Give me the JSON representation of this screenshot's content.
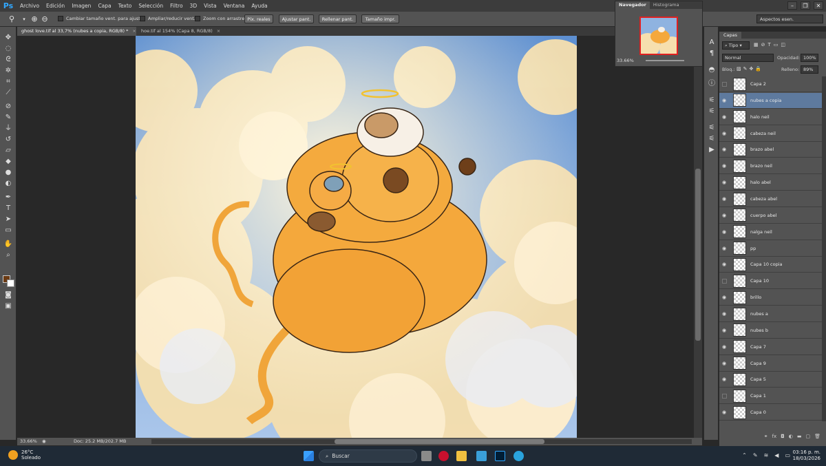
{
  "app": {
    "logo": "Ps"
  },
  "menu": [
    "Archivo",
    "Edición",
    "Imagen",
    "Capa",
    "Texto",
    "Selección",
    "Filtro",
    "3D",
    "Vista",
    "Ventana",
    "Ayuda"
  ],
  "options": {
    "check_resize": "Cambiar tamaño vent. para ajustar",
    "check_zoom_all": "Ampliar/reducir vent.",
    "check_scrubby": "Zoom con arrastre",
    "btn_actual": "Píx. reales",
    "btn_fit": "Ajustar pant.",
    "btn_fill": "Rellenar pant.",
    "btn_print": "Tamaño impr.",
    "workspace": "Aspectos esen."
  },
  "tabs": [
    {
      "label": "ghost love.tif al 33,7% (nubes a copia, RGB/8) *",
      "close": "×"
    },
    {
      "label": "hoe.tif al 154% (Capa 8, RGB/8)",
      "close": "×"
    }
  ],
  "status": {
    "zoom": "33.66%",
    "doc": "Doc: 25.2 MB/202.7 MB"
  },
  "navigator": {
    "tab_nav": "Navegador",
    "tab_hist": "Histograma",
    "zoom": "33.66%"
  },
  "layers_panel": {
    "tab": "Capas",
    "filter": "Tipo",
    "blend": "Normal",
    "opacity_label": "Opacidad:",
    "opacity": "100%",
    "lock_label": "Bloq.:",
    "fill_label": "Relleno:",
    "fill": "89%",
    "items": [
      {
        "name": "Capa 2",
        "visible": false
      },
      {
        "name": "nubes a copia",
        "visible": true,
        "selected": true
      },
      {
        "name": "halo neil",
        "visible": true
      },
      {
        "name": "cabeza neil",
        "visible": true
      },
      {
        "name": "brazo abel",
        "visible": true
      },
      {
        "name": "brazo neil",
        "visible": true
      },
      {
        "name": "halo abel",
        "visible": true
      },
      {
        "name": "cabeza abel",
        "visible": true
      },
      {
        "name": "cuerpo abel",
        "visible": true
      },
      {
        "name": "nalga neil",
        "visible": true
      },
      {
        "name": "pp",
        "visible": true
      },
      {
        "name": "Capa 10 copia",
        "visible": true
      },
      {
        "name": "Capa 10",
        "visible": false
      },
      {
        "name": "brillo",
        "visible": true
      },
      {
        "name": "nubes a",
        "visible": true
      },
      {
        "name": "nubes b",
        "visible": true
      },
      {
        "name": "Capa 7",
        "visible": true
      },
      {
        "name": "Capa 9",
        "visible": true
      },
      {
        "name": "Capa 5",
        "visible": true
      },
      {
        "name": "Capa 1",
        "visible": false
      },
      {
        "name": "Capa 0",
        "visible": true
      }
    ]
  },
  "taskbar": {
    "temp": "26°C",
    "weather": "Soleado",
    "search": "Buscar",
    "time": "03:16 p. m.",
    "date": "18/03/2026"
  },
  "colors": {
    "foreground": "#6b3a13",
    "background": "#ffffff",
    "selected_layer": "#5e7a9e"
  }
}
